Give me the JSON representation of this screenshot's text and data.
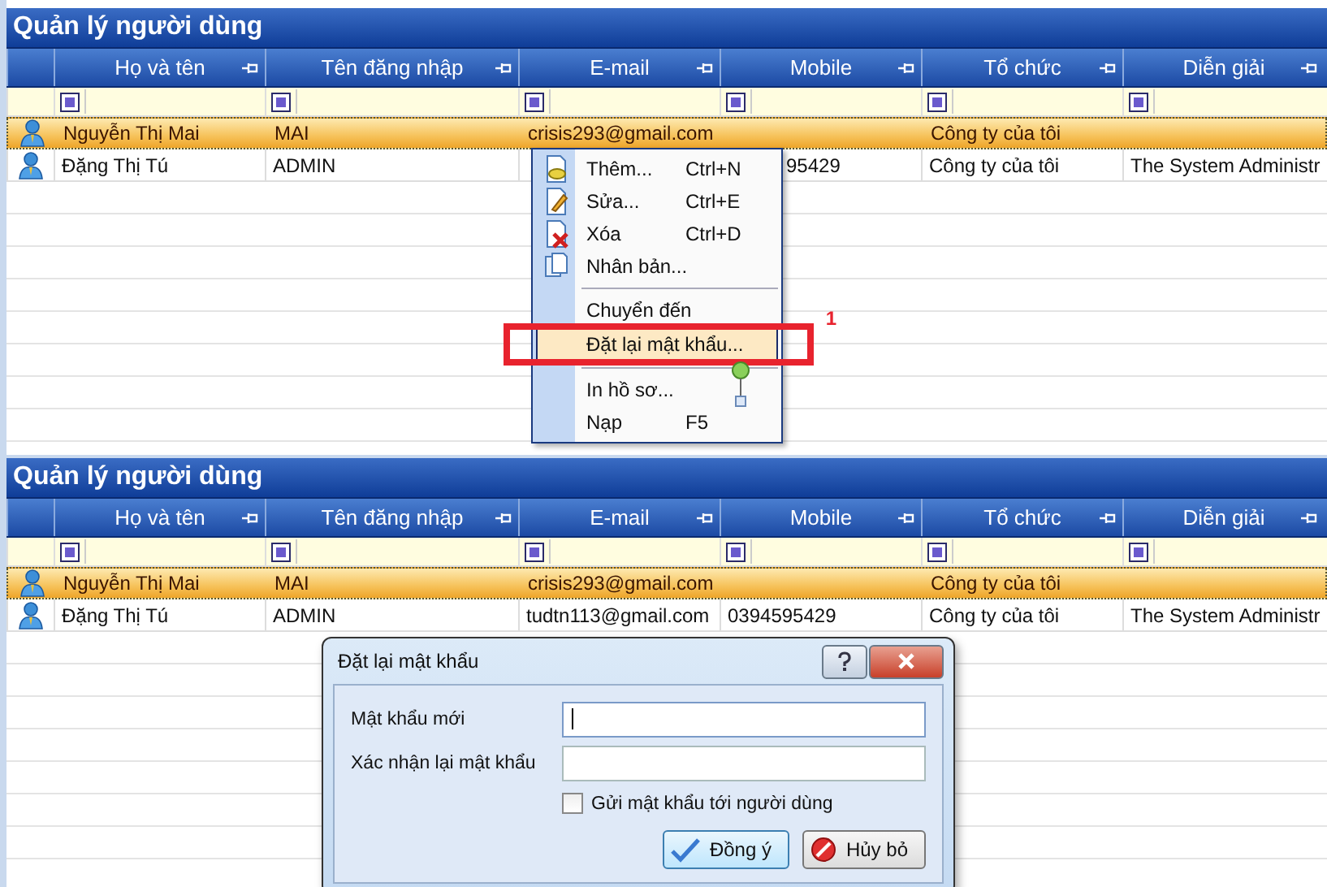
{
  "panels": [
    {
      "title": "Quản lý người dùng",
      "columns": [
        "Họ và tên",
        "Tên đăng nhập",
        "E-mail",
        "Mobile",
        "Tổ chức",
        "Diễn giải"
      ],
      "rows": [
        {
          "selected": true,
          "cells": [
            "Nguyễn Thị Mai",
            "MAI",
            "crisis293@gmail.com",
            null,
            "Công ty của tôi",
            null
          ]
        },
        {
          "selected": false,
          "cells": [
            "Đặng Thị Tú",
            "ADMIN",
            null,
            "95429",
            "Công ty của tôi",
            "The System Administr"
          ]
        }
      ],
      "context_menu": {
        "items": [
          {
            "kind": "item",
            "label": "Thêm...",
            "shortcut": "Ctrl+N",
            "selected": false
          },
          {
            "kind": "item",
            "label": "Sửa...",
            "shortcut": "Ctrl+E",
            "selected": false
          },
          {
            "kind": "item",
            "label": "Xóa",
            "shortcut": "Ctrl+D",
            "selected": false
          },
          {
            "kind": "item",
            "label": "Nhân bản...",
            "selected": false
          },
          {
            "kind": "separator"
          },
          {
            "kind": "item",
            "label": "Chuyển đến",
            "selected": false
          },
          {
            "kind": "item",
            "label": "Đặt lại mật khẩu...",
            "selected": true,
            "annotation": "1"
          },
          {
            "kind": "separator"
          },
          {
            "kind": "item",
            "label": "In hồ sơ...",
            "selected": false
          },
          {
            "kind": "item",
            "label": "Nạp",
            "shortcut": "F5",
            "selected": false
          }
        ]
      }
    },
    {
      "title": "Quản lý người dùng",
      "columns": [
        "Họ và tên",
        "Tên đăng nhập",
        "E-mail",
        "Mobile",
        "Tổ chức",
        "Diễn giải"
      ],
      "rows": [
        {
          "selected": true,
          "cells": [
            "Nguyễn Thị Mai",
            "MAI",
            "crisis293@gmail.com",
            null,
            "Công ty của tôi",
            null
          ]
        },
        {
          "selected": false,
          "cells": [
            "Đặng Thị Tú",
            "ADMIN",
            "tudtn113@gmail.com",
            "0394595429",
            "Công ty của tôi",
            "The System Administr"
          ]
        }
      ],
      "dialog": {
        "title": "Đặt lại mật khẩu",
        "fields": [
          {
            "label": "Mật khẩu mới",
            "focused": true
          },
          {
            "label": "Xác nhận lại mật khẩu",
            "focused": false
          }
        ],
        "checkbox": {
          "label": "Gửi mật khẩu tới người dùng",
          "checked": false
        },
        "buttons": [
          {
            "kind": "ok",
            "label": "Đồng ý"
          },
          {
            "kind": "cancel",
            "label": "Hủy bỏ"
          }
        ]
      }
    }
  ]
}
